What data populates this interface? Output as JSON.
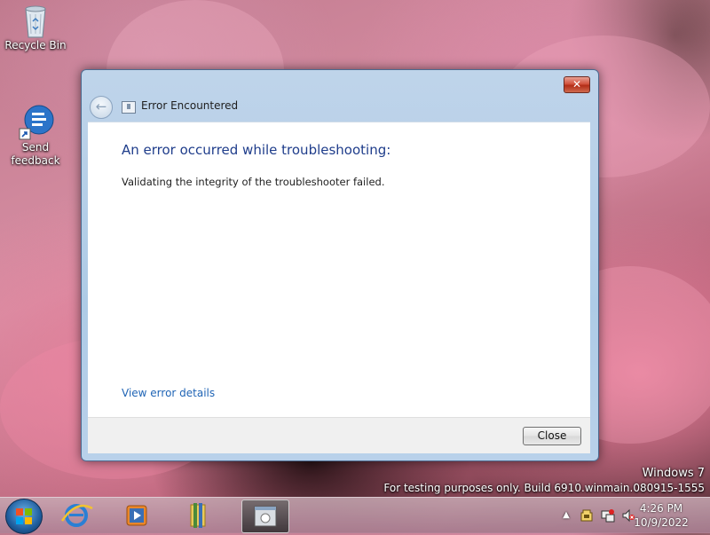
{
  "desktop": {
    "icons": [
      {
        "label": "Recycle Bin",
        "icon": "recycle-bin-icon"
      },
      {
        "label": "Send feedback",
        "icon": "feedback-icon"
      }
    ],
    "watermark": {
      "line1": "Windows 7",
      "line2": "For testing purposes only. Build 6910.winmain.080915-1555"
    }
  },
  "dialog": {
    "title": "Error Encountered",
    "close_glyph": "✕",
    "back_glyph": "←",
    "heading": "An error occurred while troubleshooting:",
    "message": "Validating the integrity of the troubleshooter failed.",
    "details_link": "View error details",
    "close_button": "Close"
  },
  "taskbar": {
    "pinned": [
      "internet-explorer-icon",
      "media-player-icon",
      "file-explorer-icon"
    ],
    "active_window": "troubleshooter-icon",
    "tray": {
      "expand_glyph": "▲",
      "icons": [
        "action-center-icon",
        "network-icon",
        "volume-muted-icon"
      ],
      "time": "4:26 PM",
      "date": "10/9/2022"
    }
  },
  "colors": {
    "heading": "#1f3d8b",
    "link": "#1f64b5",
    "close_red": "#c8412a"
  }
}
